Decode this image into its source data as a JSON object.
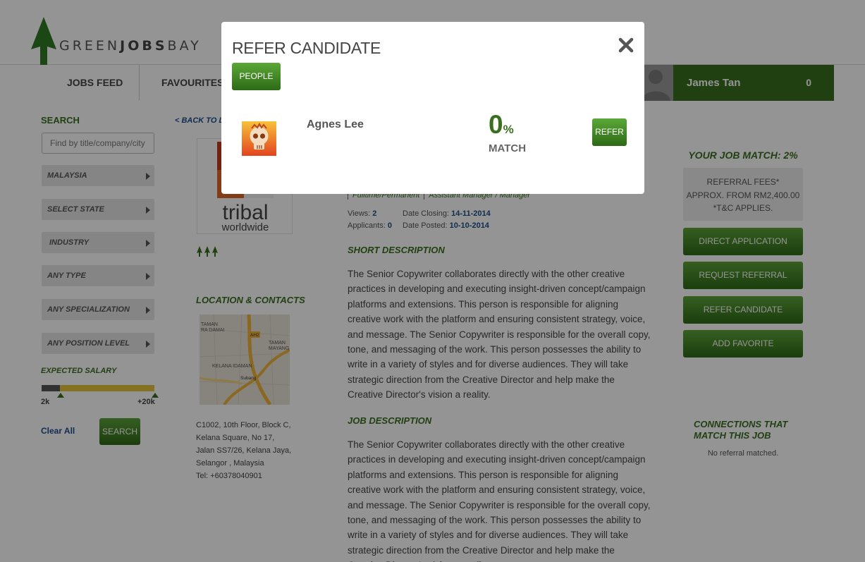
{
  "brand": {
    "logo_prefix": "GREEN",
    "logo_bold": "JOBS",
    "logo_suffix": "BAY"
  },
  "nav": {
    "items": [
      "JOBS FEED",
      "FAVOURITES"
    ]
  },
  "user": {
    "name": "James Tan",
    "count": "0"
  },
  "sidebar": {
    "search_title": "SEARCH",
    "search_placeholder": "Find by title/company/city",
    "filters": [
      "MALAYSIA",
      "SELECT STATE",
      "INDUSTRY",
      "ANY TYPE",
      "ANY SPECIALIZATION",
      "ANY POSITION LEVEL"
    ],
    "salary_title": "EXPECTED SALARY",
    "salary_min": "2k",
    "salary_max": "+20k",
    "clear_all": "Clear All",
    "search_button": "SEARCH"
  },
  "job": {
    "back_link": "< BACK TO LIST",
    "company_logo_line1": "tribal",
    "company_logo_line2": "worldwide",
    "location_title": "LOCATION & CONTACTS",
    "map_labels": [
      "TAMAN",
      "RA DAMAI",
      "AH2",
      "TAMAN",
      "MAYANG",
      "KELANA IDAMAN",
      "Subang"
    ],
    "address": "C1002, 10th Floor, Block C, Kelana Square, No 17, Jalan SS7/26, Kelana Jaya, Selangor , Malaysia",
    "tel": "Tel: +60378040901",
    "type": "Fulltime/Permanent",
    "level": "Assistant Manager / Manager",
    "views_label": "Views:",
    "views": "2",
    "applicants_label": "Applicants:",
    "applicants": "0",
    "closing_label": "Date Closing:",
    "closing": "14-11-2014",
    "posted_label": "Date Posted:",
    "posted": "10-10-2014",
    "short_title": "SHORT DESCRIPTION",
    "short_desc": "The Senior Copywriter collaborates directly with the other creative practices in developing and executing insight-driven concept/campaign platforms and extensions. This person is responsible for aligning creative work with the platform and ensuring consistent strategy, voice, and message. The Senior Copywriter is responsible for the overall copy, tone, and messaging of the work. This person possesses the ability to write in a variety of styles and for diverse audiences. They will take strategic direction from the Creative Director and help make the Creative Director's vision a reality.",
    "job_title": "JOB DESCRIPTION",
    "job_desc": "The Senior Copywriter collaborates directly with the other creative practices in developing and executing insight-driven concept/campaign platforms and extensions. This person is responsible for aligning creative work with the platform and ensuring consistent strategy, voice, and message. The Senior Copywriter is responsible for the overall copy, tone, and messaging of the work. This person possesses the ability to write in a variety of styles and for diverse audiences. They will take strategic direction from the Creative Director and help make the Creative Director's vision a reality."
  },
  "right": {
    "match": "YOUR JOB MATCH: 2%",
    "fee_line1": "REFERRAL FEES*",
    "fee_line2": "APPROX. FROM RM2,400.00",
    "fee_line3": "*T&C APPLIES.",
    "buttons": [
      "DIRECT APPLICATION",
      "REQUEST REFERRAL",
      "REFER CANDIDATE",
      "ADD FAVORITE"
    ],
    "connections_title": "CONNECTIONS THAT MATCH THIS JOB",
    "connections_empty": "No referral matched."
  },
  "modal": {
    "title": "REFER CANDIDATE",
    "tab": "PEOPLE",
    "candidate": {
      "name": "Agnes Lee",
      "match_value": "0",
      "match_unit": "%",
      "match_label": "MATCH",
      "refer_label": "REFER"
    }
  },
  "colors": {
    "brand_green": "#3a6f1f",
    "button_green": "#4a8f2a",
    "link_blue": "#1d4f8a",
    "salary_yellow": "#e3c33a"
  },
  "icons": {
    "close": "close-icon",
    "logo": "tree-logo-icon",
    "user": "user-silhouette-icon"
  }
}
